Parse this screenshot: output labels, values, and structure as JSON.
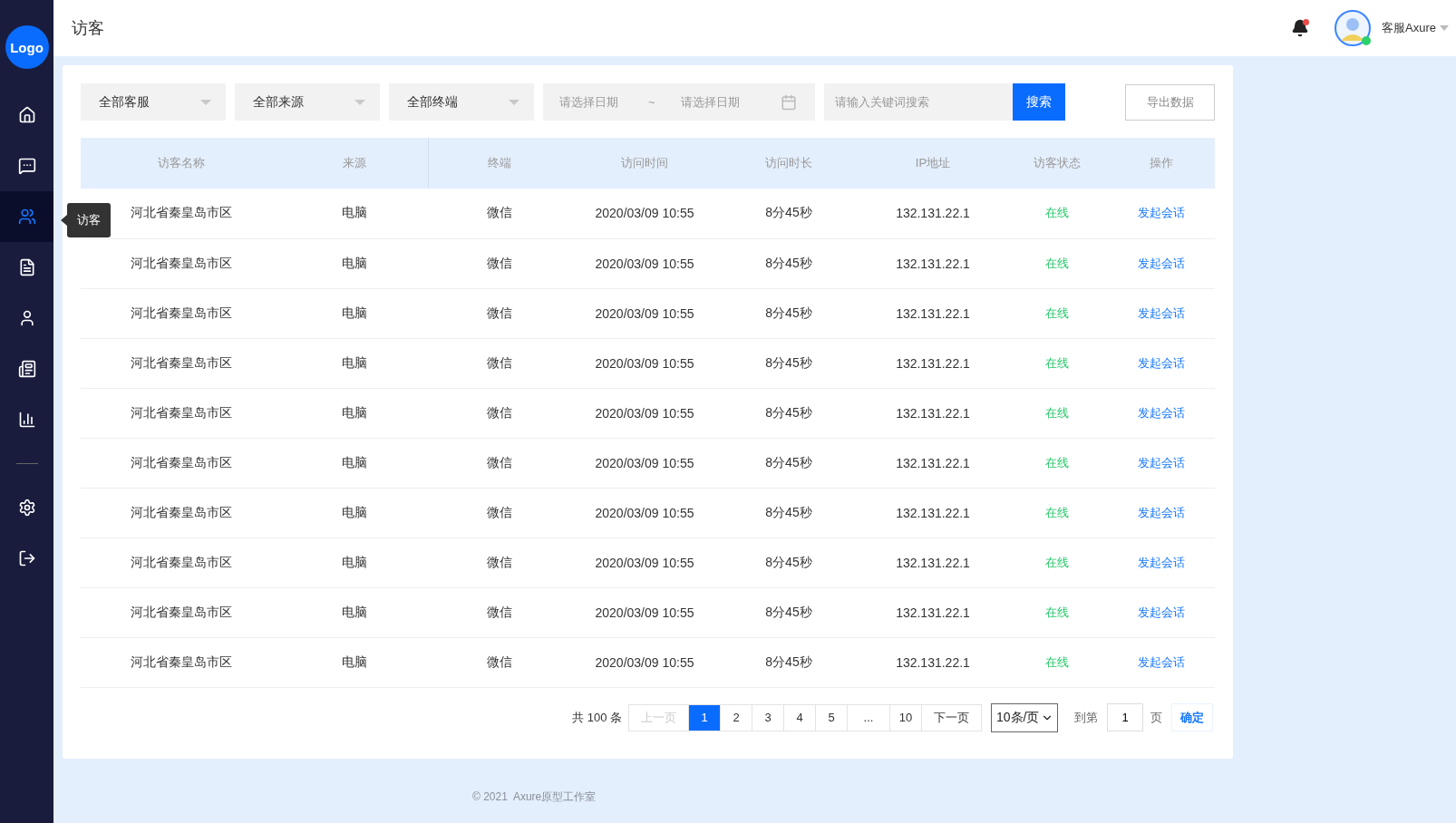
{
  "sidebar": {
    "logo": "Logo",
    "items": [
      {
        "selected": false
      },
      {
        "selected": false
      },
      {
        "selected": true,
        "tooltip": "访客"
      },
      {
        "selected": false
      },
      {
        "selected": false
      },
      {
        "selected": false
      },
      {
        "selected": false
      }
    ],
    "bottom_items": [
      {
        "selected": false
      },
      {
        "selected": false
      }
    ]
  },
  "header": {
    "title": "访客",
    "notifications": true,
    "user_name": "客服Axure",
    "online": true
  },
  "filters": {
    "selects": [
      "全部客服",
      "全部来源",
      "全部终端"
    ],
    "date_start": {
      "placeholder": "请选择日期"
    },
    "date_separator": "~",
    "date_end": {
      "placeholder": "请选择日期"
    },
    "search": {
      "placeholder": "请输入关键词搜索"
    },
    "search_button": "搜索",
    "export_button": "导出数据"
  },
  "table": {
    "columns": [
      "访客名称",
      "来源",
      "终端",
      "访问时间",
      "访问时长",
      "IP地址",
      "访客状态",
      "操作"
    ],
    "rows": [
      {
        "name": "河北省秦皇岛市区",
        "source": "电脑",
        "terminal": "微信",
        "time": "2020/03/09 10:55",
        "duration": "8分45秒",
        "ip": "132.131.22.1",
        "status": "在线",
        "action": "发起会话"
      },
      {
        "name": "河北省秦皇岛市区",
        "source": "电脑",
        "terminal": "微信",
        "time": "2020/03/09 10:55",
        "duration": "8分45秒",
        "ip": "132.131.22.1",
        "status": "在线",
        "action": "发起会话"
      },
      {
        "name": "河北省秦皇岛市区",
        "source": "电脑",
        "terminal": "微信",
        "time": "2020/03/09 10:55",
        "duration": "8分45秒",
        "ip": "132.131.22.1",
        "status": "在线",
        "action": "发起会话"
      },
      {
        "name": "河北省秦皇岛市区",
        "source": "电脑",
        "terminal": "微信",
        "time": "2020/03/09 10:55",
        "duration": "8分45秒",
        "ip": "132.131.22.1",
        "status": "在线",
        "action": "发起会话"
      },
      {
        "name": "河北省秦皇岛市区",
        "source": "电脑",
        "terminal": "微信",
        "time": "2020/03/09 10:55",
        "duration": "8分45秒",
        "ip": "132.131.22.1",
        "status": "在线",
        "action": "发起会话"
      },
      {
        "name": "河北省秦皇岛市区",
        "source": "电脑",
        "terminal": "微信",
        "time": "2020/03/09 10:55",
        "duration": "8分45秒",
        "ip": "132.131.22.1",
        "status": "在线",
        "action": "发起会话"
      },
      {
        "name": "河北省秦皇岛市区",
        "source": "电脑",
        "terminal": "微信",
        "time": "2020/03/09 10:55",
        "duration": "8分45秒",
        "ip": "132.131.22.1",
        "status": "在线",
        "action": "发起会话"
      },
      {
        "name": "河北省秦皇岛市区",
        "source": "电脑",
        "terminal": "微信",
        "time": "2020/03/09 10:55",
        "duration": "8分45秒",
        "ip": "132.131.22.1",
        "status": "在线",
        "action": "发起会话"
      },
      {
        "name": "河北省秦皇岛市区",
        "source": "电脑",
        "terminal": "微信",
        "time": "2020/03/09 10:55",
        "duration": "8分45秒",
        "ip": "132.131.22.1",
        "status": "在线",
        "action": "发起会话"
      },
      {
        "name": "河北省秦皇岛市区",
        "source": "电脑",
        "terminal": "微信",
        "time": "2020/03/09 10:55",
        "duration": "8分45秒",
        "ip": "132.131.22.1",
        "status": "在线",
        "action": "发起会话"
      }
    ]
  },
  "pagination": {
    "total": "共 100 条",
    "prev": {
      "label": "上一页",
      "disabled": true
    },
    "pages": [
      {
        "label": "1",
        "selected": true
      },
      {
        "label": "2",
        "selected": false
      },
      {
        "label": "3",
        "selected": false
      },
      {
        "label": "4",
        "selected": false
      },
      {
        "label": "5",
        "selected": false
      },
      {
        "label": "...",
        "selected": false
      },
      {
        "label": "10",
        "selected": false
      }
    ],
    "next": {
      "label": "下一页",
      "disabled": false
    },
    "page_size": "10条/页",
    "goto_label": "到第",
    "goto_value": "1",
    "goto_suffix": "页",
    "confirm": "确定"
  },
  "footer": "© 2021  Axure原型工作室"
}
